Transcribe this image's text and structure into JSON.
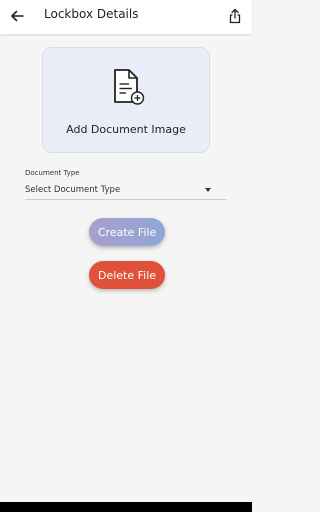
{
  "header": {
    "title": "Lockbox Details",
    "back_icon": "arrow-left-icon",
    "share_icon": "share-icon"
  },
  "document_card": {
    "label": "Add Document Image",
    "icon": "document-add-icon"
  },
  "document_type": {
    "label": "Document Type",
    "selected": "Select Document Type",
    "icon": "caret-down-icon"
  },
  "buttons": {
    "create": "Create File",
    "delete": "Delete File"
  },
  "colors": {
    "create_button": "#98a2d2",
    "delete_button": "#e0503a",
    "card_background": "#e8edf7"
  }
}
